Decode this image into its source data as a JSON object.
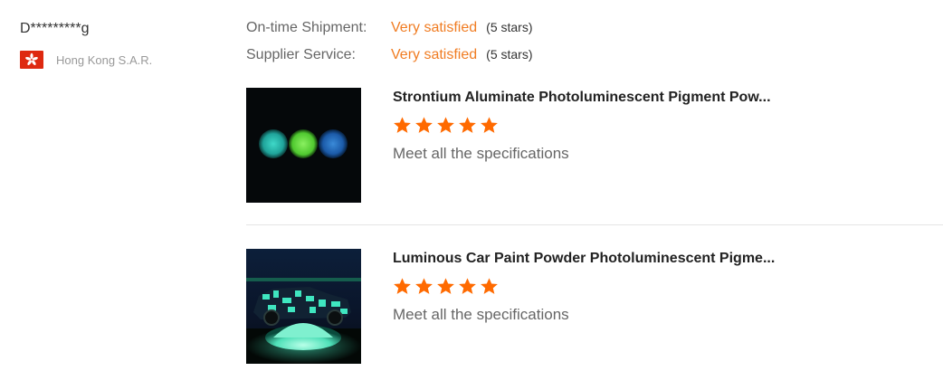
{
  "reviewer": {
    "name": "D*********g",
    "country": "Hong Kong S.A.R.",
    "flag_icon": "hong-kong-flag-icon"
  },
  "ratings": [
    {
      "label": "On-time Shipment:",
      "value": "Very satisfied",
      "count": "(5 stars)"
    },
    {
      "label": "Supplier Service:",
      "value": "Very satisfied",
      "count": "(5 stars)"
    }
  ],
  "products": [
    {
      "title": "Strontium Aluminate Photoluminescent Pigment Pow...",
      "stars": 5,
      "comment": "Meet all the specifications"
    },
    {
      "title": "Luminous Car Paint Powder Photoluminescent Pigme...",
      "stars": 5,
      "comment": "Meet all the specifications"
    }
  ],
  "colors": {
    "accent": "#f07c22",
    "star": "#ff6a00",
    "divider": "#e5e5e5"
  }
}
